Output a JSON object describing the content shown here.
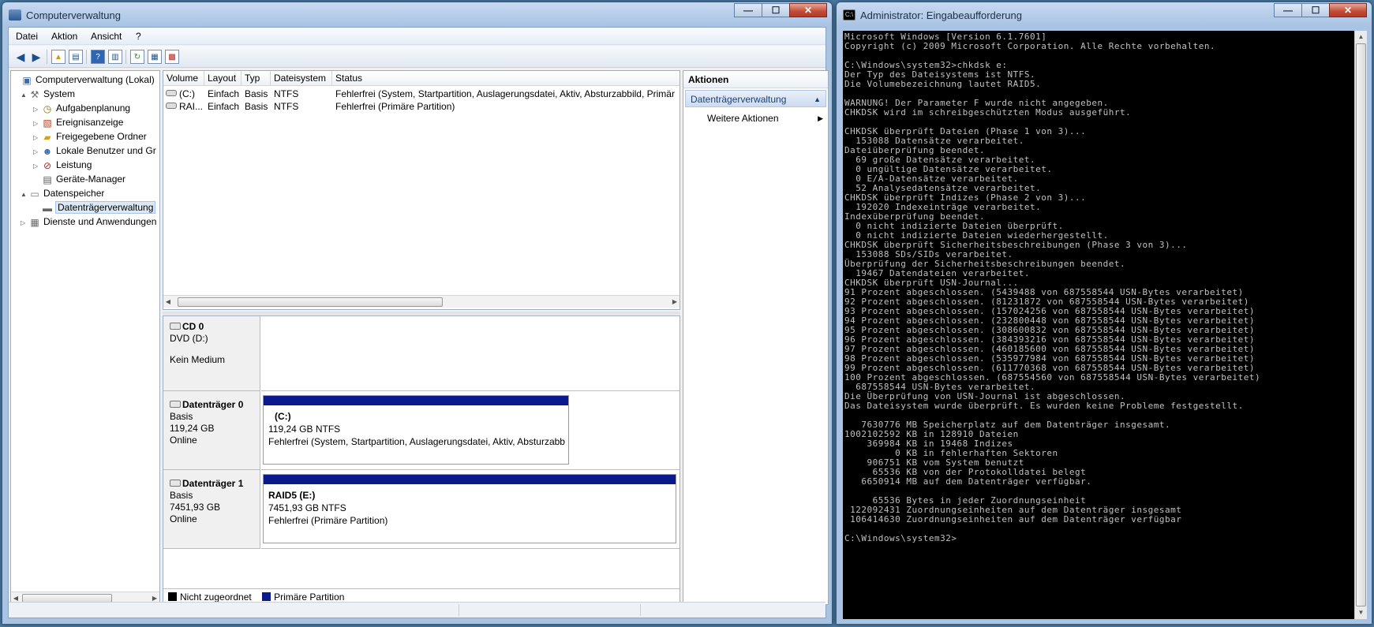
{
  "cm": {
    "title": "Computerverwaltung",
    "menu": [
      "Datei",
      "Aktion",
      "Ansicht",
      "?"
    ],
    "tree": [
      {
        "label": "Computerverwaltung (Lokal)",
        "icon": "computer-icon",
        "level": 0,
        "expander": ""
      },
      {
        "label": "System",
        "icon": "tools-icon",
        "level": 1,
        "expander": "▲"
      },
      {
        "label": "Aufgabenplanung",
        "icon": "clock-icon",
        "level": 2,
        "expander": "▷"
      },
      {
        "label": "Ereignisanzeige",
        "icon": "event-viewer-icon",
        "level": 2,
        "expander": "▷"
      },
      {
        "label": "Freigegebene Ordner",
        "icon": "shared-folder-icon",
        "level": 2,
        "expander": "▷"
      },
      {
        "label": "Lokale Benutzer und Gr",
        "icon": "users-icon",
        "level": 2,
        "expander": "▷"
      },
      {
        "label": "Leistung",
        "icon": "performance-icon",
        "level": 2,
        "expander": "▷"
      },
      {
        "label": "Geräte-Manager",
        "icon": "device-manager-icon",
        "level": 2,
        "expander": ""
      },
      {
        "label": "Datenspeicher",
        "icon": "storage-icon",
        "level": 1,
        "expander": "▲"
      },
      {
        "label": "Datenträgerverwaltung",
        "icon": "disk-management-icon",
        "level": 2,
        "expander": ""
      },
      {
        "label": "Dienste und Anwendungen",
        "icon": "services-icon",
        "level": 1,
        "expander": "▷"
      }
    ],
    "columns": [
      "Volume",
      "Layout",
      "Typ",
      "Dateisystem",
      "Status"
    ],
    "volumes": [
      [
        "(C:)",
        "Einfach",
        "Basis",
        "NTFS",
        "Fehlerfrei (System, Startpartition, Auslagerungsdatei, Aktiv, Absturzabbild, Primär"
      ],
      [
        "RAI...",
        "Einfach",
        "Basis",
        "NTFS",
        "Fehlerfrei (Primäre Partition)"
      ]
    ],
    "disks": [
      {
        "name": "CD 0",
        "lines": [
          "DVD (D:)",
          "",
          "Kein Medium"
        ],
        "partition": null
      },
      {
        "name": "Datenträger 0",
        "lines": [
          "Basis",
          "119,24 GB",
          "Online"
        ],
        "partition": {
          "title": "(C:)",
          "size": "119,24 GB NTFS",
          "status": "Fehlerfrei (System, Startpartition, Auslagerungsdatei, Aktiv, Absturzabb"
        }
      },
      {
        "name": "Datenträger 1",
        "lines": [
          "Basis",
          "7451,93 GB",
          "Online"
        ],
        "partition": {
          "title": "RAID5  (E:)",
          "size": "7451,93 GB NTFS",
          "status": "Fehlerfrei (Primäre Partition)"
        }
      }
    ],
    "legend": [
      {
        "label": "Nicht zugeordnet",
        "color": "#000000"
      },
      {
        "label": "Primäre Partition",
        "color": "#0a1a8c"
      }
    ],
    "actions": {
      "header": "Aktionen",
      "section": "Datenträgerverwaltung",
      "item": "Weitere Aktionen"
    }
  },
  "cmd": {
    "title": "Administrator: Eingabeaufforderung",
    "lines": [
      "Microsoft Windows [Version 6.1.7601]",
      "Copyright (c) 2009 Microsoft Corporation. Alle Rechte vorbehalten.",
      "",
      "C:\\Windows\\system32>chkdsk e:",
      "Der Typ des Dateisystems ist NTFS.",
      "Die Volumebezeichnung lautet RAID5.",
      "",
      "WARNUNG! Der Parameter F wurde nicht angegeben.",
      "CHKDSK wird im schreibgeschützten Modus ausgeführt.",
      "",
      "CHKDSK überprüft Dateien (Phase 1 von 3)...",
      "  153088 Datensätze verarbeitet.",
      "Dateiüberprüfung beendet.",
      "  69 große Datensätze verarbeitet.",
      "  0 ungültige Datensätze verarbeitet.",
      "  0 E/A-Datensätze verarbeitet.",
      "  52 Analysedatensätze verarbeitet.",
      "CHKDSK überprüft Indizes (Phase 2 von 3)...",
      "  192020 Indexeinträge verarbeitet.",
      "Indexüberprüfung beendet.",
      "  0 nicht indizierte Dateien überprüft.",
      "  0 nicht indizierte Dateien wiederhergestellt.",
      "CHKDSK überprüft Sicherheitsbeschreibungen (Phase 3 von 3)...",
      "  153088 SDs/SIDs verarbeitet.",
      "Überprüfung der Sicherheitsbeschreibungen beendet.",
      "  19467 Datendateien verarbeitet.",
      "CHKDSK überprüft USN-Journal...",
      "91 Prozent abgeschlossen. (5439488 von 687558544 USN-Bytes verarbeitet)",
      "92 Prozent abgeschlossen. (81231872 von 687558544 USN-Bytes verarbeitet)",
      "93 Prozent abgeschlossen. (157024256 von 687558544 USN-Bytes verarbeitet)",
      "94 Prozent abgeschlossen. (232800448 von 687558544 USN-Bytes verarbeitet)",
      "95 Prozent abgeschlossen. (308600832 von 687558544 USN-Bytes verarbeitet)",
      "96 Prozent abgeschlossen. (384393216 von 687558544 USN-Bytes verarbeitet)",
      "97 Prozent abgeschlossen. (460185600 von 687558544 USN-Bytes verarbeitet)",
      "98 Prozent abgeschlossen. (535977984 von 687558544 USN-Bytes verarbeitet)",
      "99 Prozent abgeschlossen. (611770368 von 687558544 USN-Bytes verarbeitet)",
      "100 Prozent abgeschlossen. (687554560 von 687558544 USN-Bytes verarbeitet)",
      "  687558544 USN-Bytes verarbeitet.",
      "Die Überprüfung von USN-Journal ist abgeschlossen.",
      "Das Dateisystem wurde überprüft. Es wurden keine Probleme festgestellt.",
      "",
      "   7630776 MB Speicherplatz auf dem Datenträger insgesamt.",
      "1002102592 KB in 128910 Dateien",
      "    369984 KB in 19468 Indizes",
      "         0 KB in fehlerhaften Sektoren",
      "    906751 KB vom System benutzt",
      "     65536 KB von der Protokolldatei belegt",
      "   6650914 MB auf dem Datenträger verfügbar.",
      "",
      "     65536 Bytes in jeder Zuordnungseinheit",
      " 122092431 Zuordnungseinheiten auf dem Datenträger insgesamt",
      " 106414630 Zuordnungseinheiten auf dem Datenträger verfügbar",
      "",
      "C:\\Windows\\system32>"
    ]
  },
  "window_buttons": {
    "minimize": "—",
    "maximize": "☐",
    "close": "✕"
  }
}
